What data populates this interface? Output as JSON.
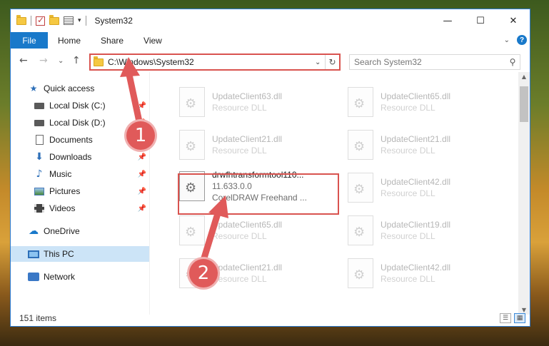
{
  "window": {
    "title": "System32"
  },
  "titlebar": {
    "minimize": "—",
    "maximize": "☐",
    "close": "✕"
  },
  "ribbon": {
    "tabs": [
      "File",
      "Home",
      "Share",
      "View"
    ]
  },
  "address": {
    "path": "C:\\Windows\\System32"
  },
  "search": {
    "placeholder": "Search System32"
  },
  "sidebar": {
    "items": [
      {
        "label": "Quick access"
      },
      {
        "label": "Local Disk (C:)"
      },
      {
        "label": "Local Disk (D:)"
      },
      {
        "label": "Documents"
      },
      {
        "label": "Downloads"
      },
      {
        "label": "Music"
      },
      {
        "label": "Pictures"
      },
      {
        "label": "Videos"
      },
      {
        "label": "OneDrive"
      },
      {
        "label": "This PC"
      },
      {
        "label": "Network"
      }
    ]
  },
  "files": [
    {
      "name": "UpdateClient63.dll",
      "sub": "Resource DLL"
    },
    {
      "name": "UpdateClient65.dll",
      "sub": "Resource DLL"
    },
    {
      "name": "UpdateClient21.dll",
      "sub": "Resource DLL"
    },
    {
      "name": "UpdateClient21.dll",
      "sub": "Resource DLL"
    },
    {
      "name": "drwfhtransformtool110...",
      "version": "11.633.0.0",
      "sub": "CorelDRAW Freehand ..."
    },
    {
      "name": "UpdateClient42.dll",
      "sub": "Resource DLL"
    },
    {
      "name": "UpdateClient65.dll",
      "sub": "Resource DLL"
    },
    {
      "name": "UpdateClient19.dll",
      "sub": "Resource DLL"
    },
    {
      "name": "UpdateClient21.dll",
      "sub": "Resource DLL"
    },
    {
      "name": "UpdateClient42.dll",
      "sub": "Resource DLL"
    }
  ],
  "status": {
    "count": "151 items"
  },
  "annotations": {
    "step1": "1",
    "step2": "2"
  },
  "colors": {
    "accent": "#1979ca",
    "highlight": "#d9534f",
    "badge": "#e05a5a"
  }
}
